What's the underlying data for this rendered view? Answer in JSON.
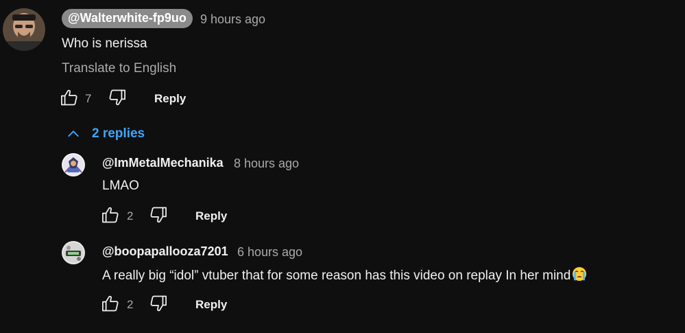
{
  "comment": {
    "author": "@Walterwhite-fp9uo",
    "time": "9 hours ago",
    "text": "Who is nerissa",
    "translate_label": "Translate to English",
    "like_count": "7",
    "reply_label": "Reply"
  },
  "replies_toggle": {
    "label": "2 replies"
  },
  "replies": [
    {
      "author": "@ImMetalMechanika",
      "time": "8 hours ago",
      "text": "LMAO",
      "like_count": "2",
      "reply_label": "Reply"
    },
    {
      "author": "@boopapallooza7201",
      "time": "6 hours ago",
      "text": "A really big “idol” vtuber that for some reason has this video on replay In her mind",
      "emoji": "crying-face-emoji",
      "like_count": "2",
      "reply_label": "Reply"
    }
  ],
  "icons": {
    "like": "thumbs-up-icon",
    "dislike": "thumbs-down-icon",
    "collapse": "chevron-up-icon"
  },
  "colors": {
    "background": "#0f0f0f",
    "link_blue": "#3ea6ff",
    "secondary_text": "#aaaaaa",
    "author_pill": "#8a8a8a"
  }
}
